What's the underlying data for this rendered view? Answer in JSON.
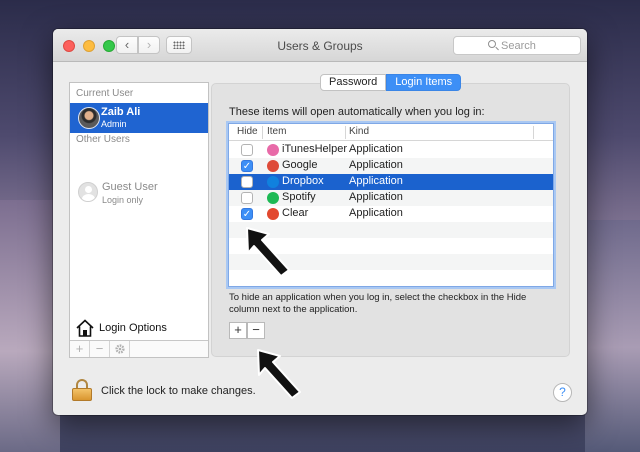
{
  "window": {
    "title": "Users & Groups",
    "nav": {
      "back_glyph": "‹",
      "forward_glyph": "›"
    },
    "search": {
      "placeholder": "Search"
    }
  },
  "sidebar": {
    "current_user_header": "Current User",
    "current_user": {
      "name": "Zaib Ali",
      "role": "Admin"
    },
    "other_users_header": "Other Users",
    "other_users": [
      {
        "name": "Guest User",
        "role": "Login only"
      }
    ],
    "login_options_label": "Login Options",
    "toolbar": {
      "add": "+",
      "remove": "−"
    }
  },
  "tabs": [
    {
      "label": "Password",
      "active": false
    },
    {
      "label": "Login Items",
      "active": true
    }
  ],
  "login_items": {
    "intro": "These items will open automatically when you log in:",
    "columns": {
      "hide": "Hide",
      "item": "Item",
      "kind": "Kind"
    },
    "rows": [
      {
        "name": "iTunesHelper",
        "kind": "Application",
        "hide": false,
        "selected": false,
        "icon": "itunes-icon",
        "color": "#e86aa8"
      },
      {
        "name": "Google",
        "kind": "Application",
        "hide": true,
        "selected": false,
        "icon": "chrome-icon",
        "color": "#de4b39"
      },
      {
        "name": "Dropbox",
        "kind": "Application",
        "hide": false,
        "selected": true,
        "icon": "dropbox-icon",
        "color": "#1081de"
      },
      {
        "name": "Spotify",
        "kind": "Application",
        "hide": false,
        "selected": false,
        "icon": "spotify-icon",
        "color": "#1db954"
      },
      {
        "name": "Clear",
        "kind": "Application",
        "hide": true,
        "selected": false,
        "icon": "clear-icon",
        "color": "#e2482f"
      }
    ],
    "hint": "To hide an application when you log in, select the checkbox in the Hide column next to the application.",
    "add_label": "+",
    "remove_label": "−"
  },
  "footer": {
    "lock_text": "Click the lock to make changes.",
    "help_label": "?"
  },
  "colors": {
    "selection": "#1b62ce",
    "accent": "#3d8ff6"
  }
}
